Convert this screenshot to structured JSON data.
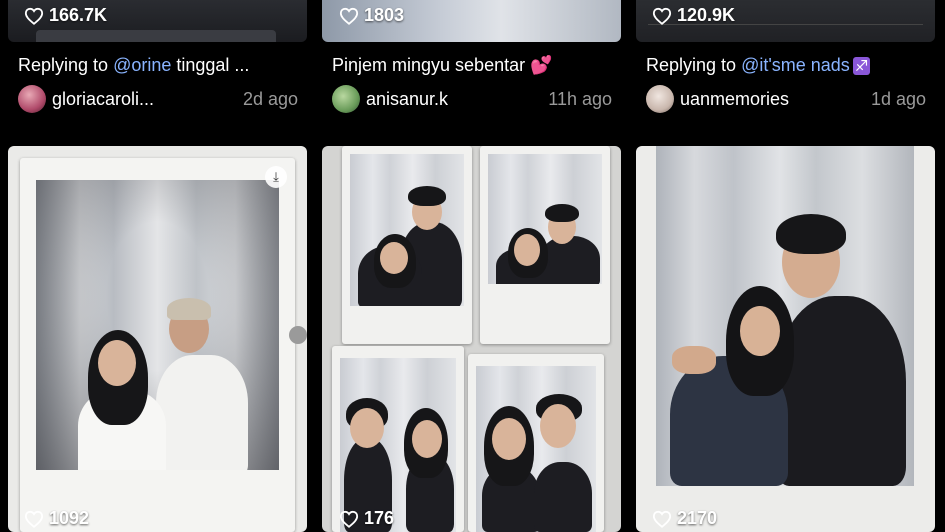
{
  "top_row": [
    {
      "likes": "166.7K",
      "caption_prefix": "Replying to ",
      "mention": "@orine",
      "caption_suffix": " tinggal ...",
      "username": "gloriacaroli...",
      "time": "2d ago"
    },
    {
      "likes": "1803",
      "caption_prefix": "Pinjem mingyu sebentar ",
      "mention": "",
      "caption_suffix": "",
      "emoji": "💕",
      "username": "anisanur.k",
      "time": "11h ago"
    },
    {
      "likes": "120.9K",
      "caption_prefix": "Replying to ",
      "mention": "@it'sme nads",
      "caption_suffix": "",
      "emoji": "♐",
      "username": "uanmemories",
      "time": "1d ago"
    }
  ],
  "bottom_row": [
    {
      "likes": "1092"
    },
    {
      "likes": "176"
    },
    {
      "likes": "2170"
    }
  ],
  "colors": {
    "mention": "#8ab4ff",
    "time": "#9a9a9a",
    "background": "#000000"
  },
  "icons": {
    "like": "heart-outline-icon",
    "download": "download-icon"
  }
}
